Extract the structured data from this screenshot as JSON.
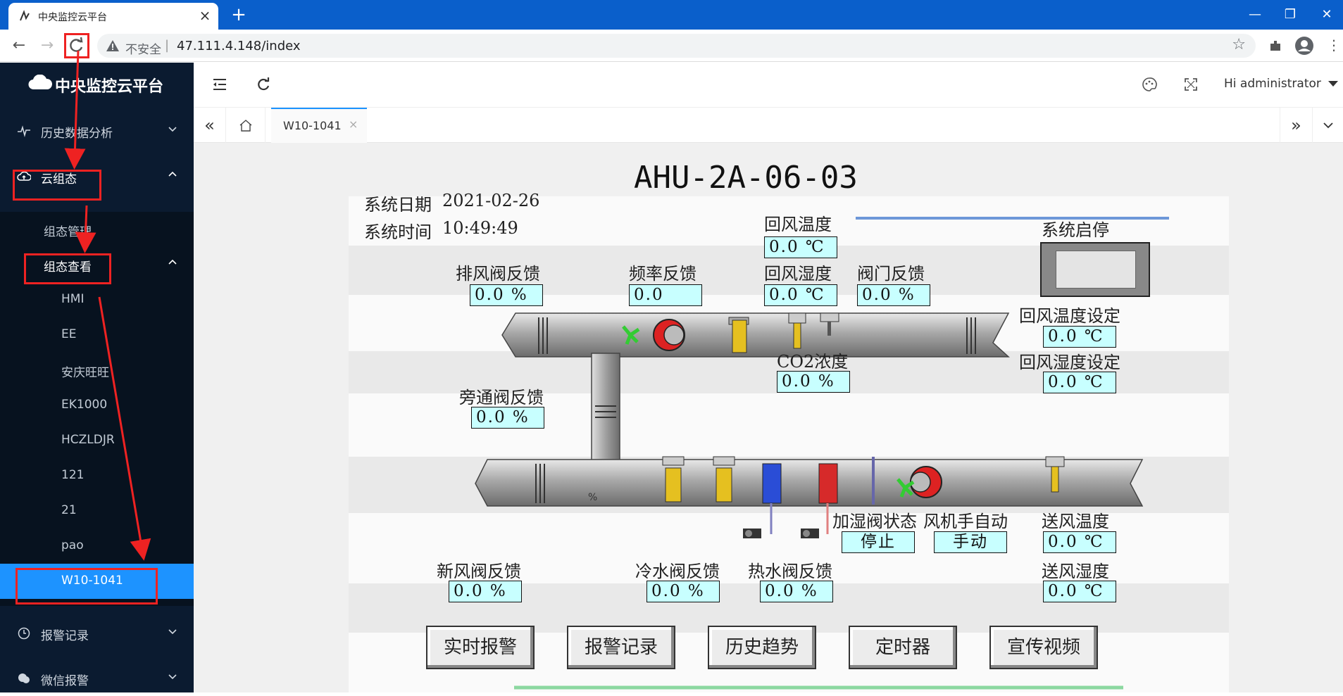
{
  "browser": {
    "tab_title": "中央监控云平台",
    "insecure_label": "不安全",
    "url": "47.111.4.148/index"
  },
  "app": {
    "logo": "中央监控云平台",
    "user": "Hi administrator"
  },
  "sidebar": {
    "menu": [
      {
        "label": "历史数据分析",
        "icon": "pulse-icon"
      },
      {
        "label": "云组态",
        "icon": "cloud-upload-icon"
      },
      {
        "label": "报警记录",
        "icon": "clock-icon"
      },
      {
        "label": "微信报警",
        "icon": "wechat-icon"
      }
    ],
    "sub": {
      "manage": "组态管理",
      "view": "组态查看",
      "items": [
        "HMI",
        "EE",
        "安庆旺旺",
        "EK1000",
        "HCZLDJR",
        "121",
        "21",
        "pao",
        "W10-1041"
      ]
    }
  },
  "tabs": {
    "active": "W10-1041"
  },
  "hmi": {
    "title": "AHU-2A-06-03",
    "date_label": "系统日期",
    "date_value": "2021-02-26",
    "time_label": "系统时间",
    "time_value": "10:49:49",
    "labels": {
      "return_temp": "回风温度",
      "return_humid": "回风湿度",
      "exhaust_damper": "排风阀反馈",
      "freq": "频率反馈",
      "valve_fb": "阀门反馈",
      "co2": "CO2浓度",
      "bypass": "旁通阀反馈",
      "startstop": "系统启停",
      "return_temp_set": "回风温度设定",
      "return_humid_set": "回风湿度设定",
      "humid_valve": "加湿阀状态",
      "fan_mode": "风机手自动",
      "supply_temp": "送风温度",
      "supply_humid": "送风湿度",
      "fresh_damper": "新风阀反馈",
      "chilled_valve": "冷水阀反馈",
      "hot_valve": "热水阀反馈"
    },
    "values": {
      "return_temp": "0.0 ℃",
      "return_humid": "0.0 ℃",
      "exhaust_damper": "0.0 %",
      "freq": "0.0",
      "valve_fb": "0.0 %",
      "co2": "0.0 %",
      "bypass": "0.0 %",
      "return_temp_set": "0.0 ℃",
      "return_humid_set": "0.0 ℃",
      "humid_valve": "停止",
      "fan_mode": "手动",
      "supply_temp": "0.0 ℃",
      "supply_humid": "0.0 ℃",
      "fresh_damper": "0.0 %",
      "chilled_valve": "0.0 %",
      "hot_valve": "0.0 %"
    },
    "pct_glyph": "%",
    "buttons": [
      "实时报警",
      "报警记录",
      "历史趋势",
      "定时器",
      "宣传视频"
    ]
  },
  "colors": {
    "chrome_blue": "#0a5fcb",
    "sidebar_bg": "#0b1b30",
    "active_item": "#1d93ff",
    "value_bg": "#c8ffff",
    "annotation_red": "#ee2222"
  }
}
